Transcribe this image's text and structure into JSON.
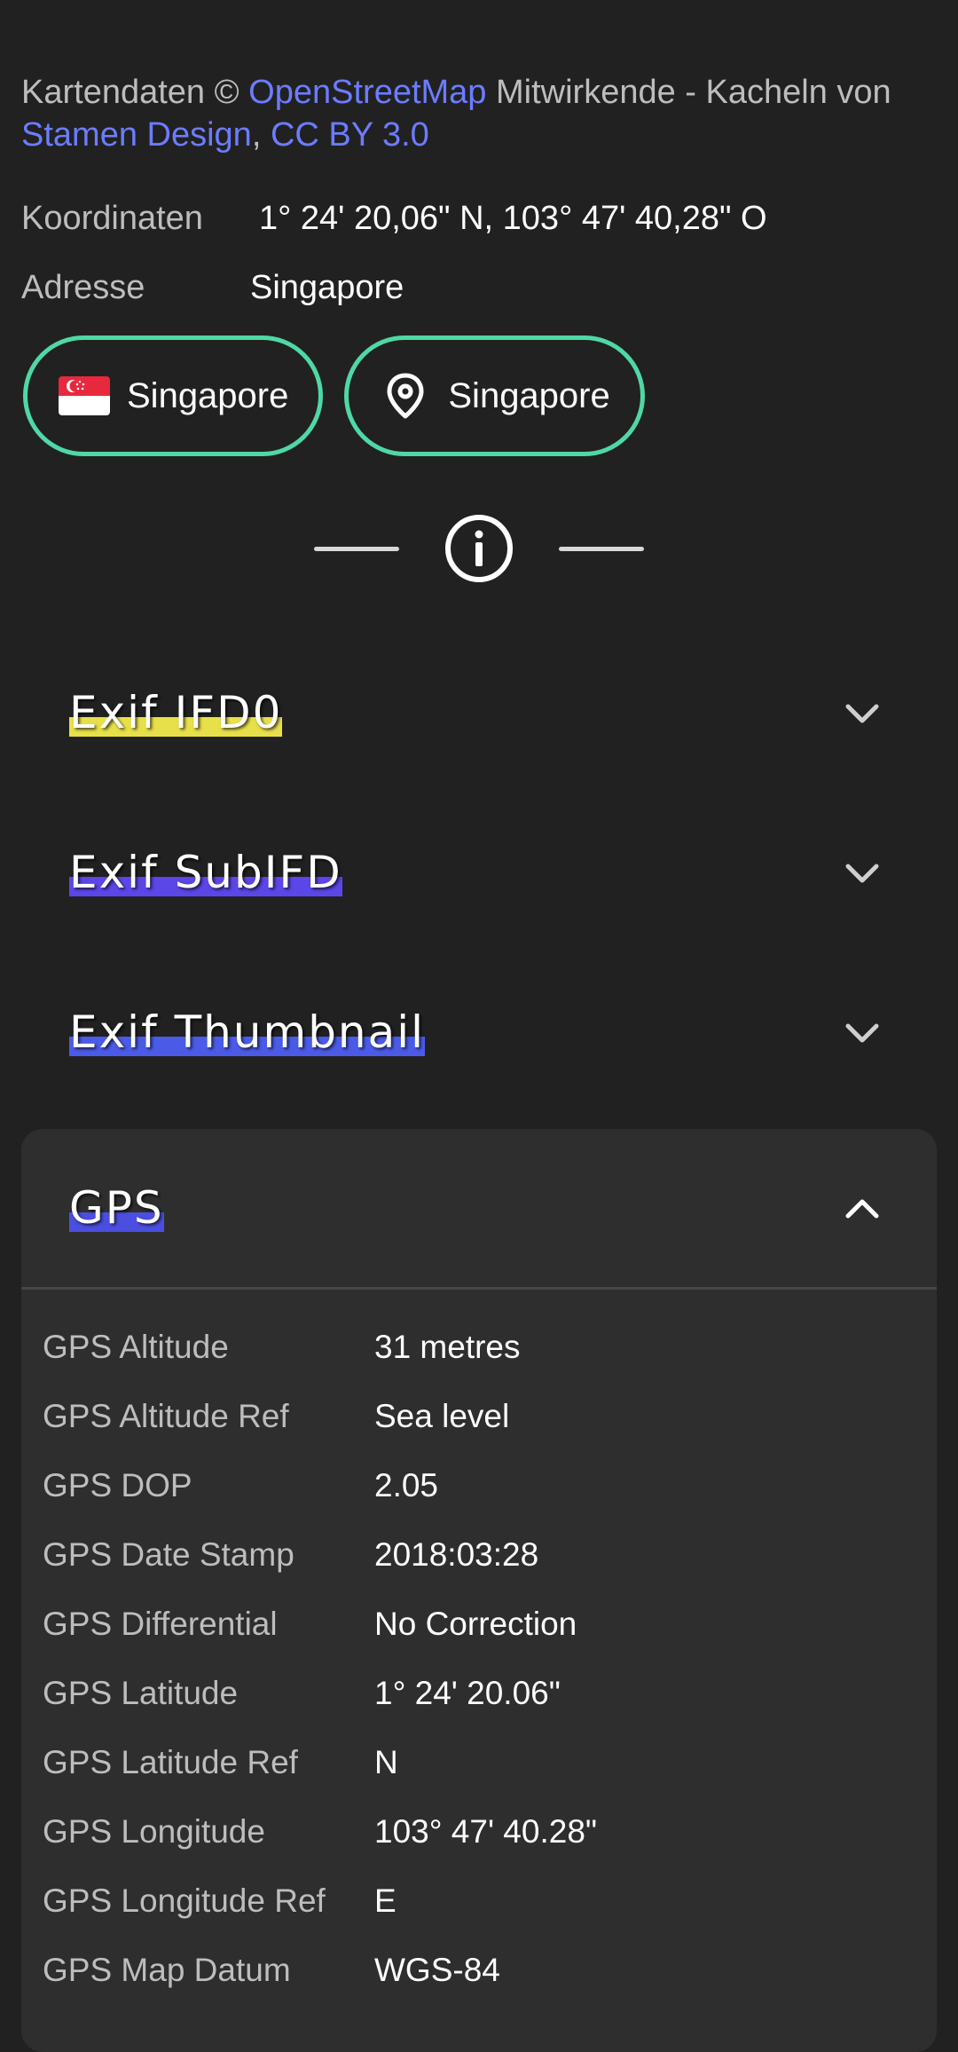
{
  "map": {
    "attribution_prefix": "Kartendaten ©",
    "attribution_link_osm": "OpenStreetMap",
    "attribution_middle": "Mitwirkende - Kacheln von",
    "attribution_link_stamen": "Stamen Design",
    "attribution_comma": ",",
    "attribution_link_cc": "CC BY 3.0"
  },
  "location": {
    "coordinates_label": "Koordinaten",
    "coordinates_value": "1° 24' 20,06\" N,  103° 47' 40,28\" O",
    "address_label": "Adresse",
    "address_value": "Singapore"
  },
  "chips": [
    {
      "label": "Singapore",
      "icon": "singapore-flag-icon"
    },
    {
      "label": "Singapore",
      "icon": "location-pin-icon"
    }
  ],
  "sections": [
    {
      "title": "Exif IFD0",
      "highlight": "#e8e04a",
      "expanded": false
    },
    {
      "title": "Exif SubIFD",
      "highlight": "#5b46e8",
      "expanded": false
    },
    {
      "title": "Exif Thumbnail",
      "highlight": "#4b5be8",
      "expanded": false
    },
    {
      "title": "GPS",
      "highlight": "#4b4fe0",
      "expanded": true
    }
  ],
  "gps": [
    {
      "key": "GPS Altitude",
      "value": "31 metres"
    },
    {
      "key": "GPS Altitude Ref",
      "value": "Sea level"
    },
    {
      "key": "GPS DOP",
      "value": "2.05"
    },
    {
      "key": "GPS Date Stamp",
      "value": "2018:03:28"
    },
    {
      "key": "GPS Differential",
      "value": "No Correction"
    },
    {
      "key": "GPS Latitude",
      "value": "1° 24' 20.06\""
    },
    {
      "key": "GPS Latitude Ref",
      "value": "N"
    },
    {
      "key": "GPS Longitude",
      "value": "103° 47' 40.28\""
    },
    {
      "key": "GPS Longitude Ref",
      "value": "E"
    },
    {
      "key": "GPS Map Datum",
      "value": "WGS-84"
    }
  ],
  "colors": {
    "background": "#212121",
    "card": "#2e2e2e",
    "chip_border": "#4fd8a6",
    "link": "#6c7cff"
  }
}
